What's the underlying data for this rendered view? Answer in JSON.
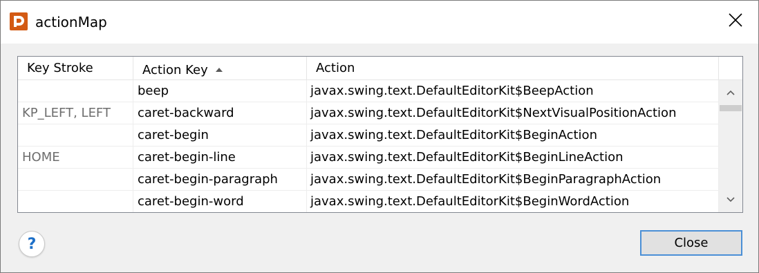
{
  "window": {
    "title": "actionMap",
    "icon": "app-logo-icon",
    "accent_color": "#d35a14"
  },
  "table": {
    "columns": [
      {
        "label": "Key Stroke"
      },
      {
        "label": "Action Key",
        "sort": "ascending"
      },
      {
        "label": "Action"
      }
    ],
    "rows": [
      {
        "key_stroke": "",
        "action_key": "beep",
        "action": "javax.swing.text.DefaultEditorKit$BeepAction"
      },
      {
        "key_stroke": "KP_LEFT, LEFT",
        "action_key": "caret-backward",
        "action": "javax.swing.text.DefaultEditorKit$NextVisualPositionAction"
      },
      {
        "key_stroke": "",
        "action_key": "caret-begin",
        "action": "javax.swing.text.DefaultEditorKit$BeginAction"
      },
      {
        "key_stroke": "HOME",
        "action_key": "caret-begin-line",
        "action": "javax.swing.text.DefaultEditorKit$BeginLineAction"
      },
      {
        "key_stroke": "",
        "action_key": "caret-begin-paragraph",
        "action": "javax.swing.text.DefaultEditorKit$BeginParagraphAction"
      },
      {
        "key_stroke": "",
        "action_key": "caret-begin-word",
        "action": "javax.swing.text.DefaultEditorKit$BeginWordAction"
      }
    ]
  },
  "buttons": {
    "help_label": "?",
    "close_label": "Close"
  },
  "colors": {
    "help_blue": "#1c6fc8",
    "focus_border": "#4a8fd6"
  }
}
